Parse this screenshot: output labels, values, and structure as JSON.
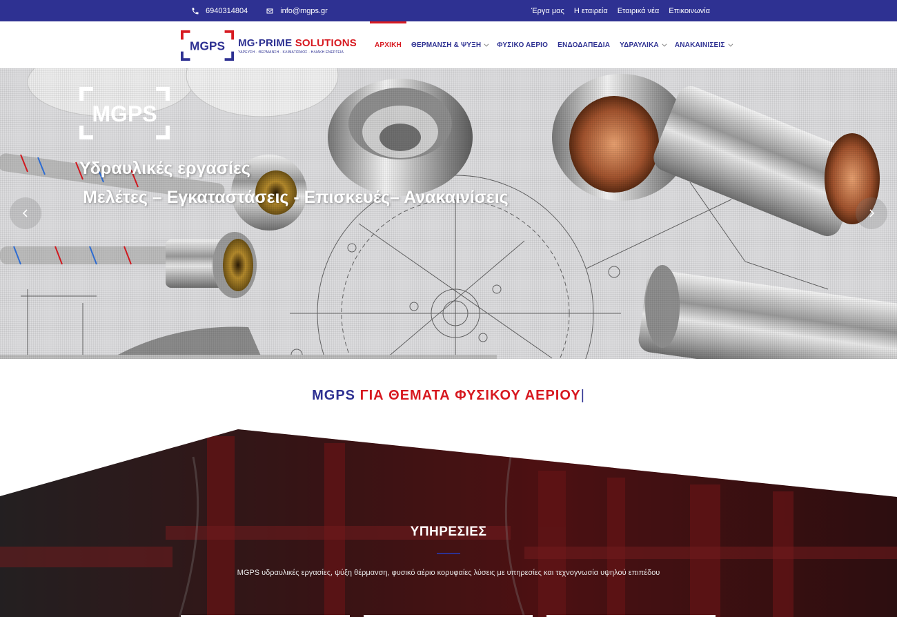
{
  "topbar": {
    "phone": "6940314804",
    "email": "info@mgps.gr",
    "links": [
      "Έργα μας",
      "Η εταιρεία",
      "Εταιρικά νέα",
      "Επικοινωνία"
    ]
  },
  "logo": {
    "mark_text": "MGPS",
    "brand_part1": "MG·PRIME",
    "brand_part2": " SOLUTIONS",
    "tagline": "ΥΔΡΕΥΣΗ · ΘΕΡΜΑΝΣΗ · ΚΛΙΜΑΤΙΣΜΟΣ · ΗΛΙΑΚΗ ΕΝΕΡΓΕΙΑ"
  },
  "nav": {
    "items": [
      {
        "label": "ΑΡΧΙΚΗ",
        "active": true,
        "dropdown": false
      },
      {
        "label": "ΘΕΡΜΑΝΣΗ & ΨΥΞΗ",
        "active": false,
        "dropdown": true
      },
      {
        "label": "ΦΥΣΙΚΟ ΑΕΡΙΟ",
        "active": false,
        "dropdown": false
      },
      {
        "label": "ΕΝΔΟΔΑΠΕΔΙΑ",
        "active": false,
        "dropdown": false
      },
      {
        "label": "ΥΔΡΑΥΛΙΚΑ",
        "active": false,
        "dropdown": true
      },
      {
        "label": "ΑΝΑΚΑΙΝΙΣΕΙΣ",
        "active": false,
        "dropdown": true
      }
    ]
  },
  "hero": {
    "logo_text": "MGPS",
    "title": "Υδραυλικές εργασίες",
    "subtitle": "Μελέτες – Εγκαταστάσεις - Επισκευές– Ανακαινίσεις"
  },
  "tagline": {
    "part1": "MGPS",
    "part2": " ΓΙΑ ΘΕΜΑΤΑ ΦΥΣΙΚΟΥ ΑΕΡΙΟΥ",
    "cursor": "|"
  },
  "services": {
    "title": "ΥΠΗΡΕΣΙΕΣ",
    "description": "MGPS υδραυλικές εργασίες, ψύξη θέρμανση, φυσικό αέριο κορυφαίες λύσεις με υπηρεσίες και τεχνογνωσία υψηλού επιπέδου"
  },
  "colors": {
    "brand_blue": "#2e3192",
    "brand_red": "#d71920"
  }
}
